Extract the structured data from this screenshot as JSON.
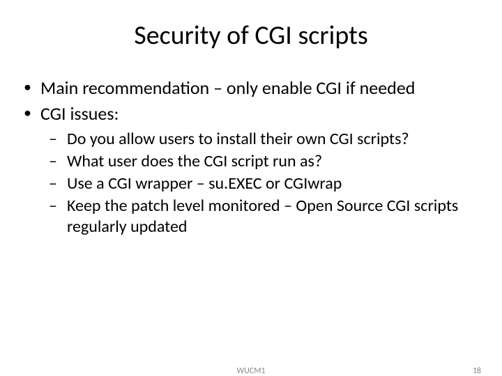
{
  "title": "Security of CGI scripts",
  "bullets": {
    "b0": "Main recommendation – only enable CGI if needed",
    "b1": "CGI issues:",
    "sub": {
      "s0": "Do you allow users to install their own CGI scripts?",
      "s1": "What user does the CGI script run as?",
      "s2": "Use a CGI wrapper – su.EXEC or CGIwrap",
      "s3": "Keep the patch level monitored – Open Source CGI scripts regularly updated"
    }
  },
  "footer": {
    "center": "WUCM1",
    "page": "18"
  }
}
